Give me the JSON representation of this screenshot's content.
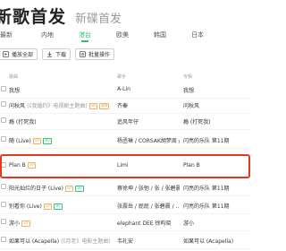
{
  "header": {
    "title": "新歌首发",
    "subtitle": "新碟首发"
  },
  "tabs": [
    {
      "label": "最新"
    },
    {
      "label": "内地"
    },
    {
      "label": "港台"
    },
    {
      "label": "欧美"
    },
    {
      "label": "韩国"
    },
    {
      "label": "日本"
    }
  ],
  "toolbar": {
    "play_all": "播放全部",
    "download": "下载",
    "batch": "批量操作"
  },
  "columns": {
    "title": "歌曲",
    "singer": "歌手",
    "album": "专辑"
  },
  "songs": [
    {
      "title": "我想",
      "alias": "",
      "tags": [],
      "singer": "A-Lin",
      "album": "我想"
    },
    {
      "title": "问秋风",
      "alias": "(《我婚约》电视剧主题曲)",
      "tags": [
        "VIP",
        "超清"
      ],
      "singer": "齐秦",
      "album": "问秋风"
    },
    {
      "title": "瘾 (打死我)",
      "alias": "",
      "tags": [],
      "singer": "追风年仔",
      "album": "瘾 (打死我)"
    },
    {
      "title": "随 (Live)",
      "alias": "",
      "tags": [
        "VIP",
        "MV"
      ],
      "singer": "杨丞琳 / CORSAK胡梦周 / ...",
      "album": "闪亮的乐队 第11期"
    },
    {
      "title": "Plan B",
      "alias": "",
      "tags": [
        "VIP"
      ],
      "singer": "Limi",
      "album": "Plan B"
    },
    {
      "title": "阳光灿烂的日子 (Live)",
      "alias": "",
      "tags": [
        "VIP",
        "MV"
      ],
      "singer": "蔡徐坤 / 张弛 / 张 / 张碧晨",
      "album": "闪亮的乐队 第11期"
    },
    {
      "title": "别看你 (Live)",
      "alias": "",
      "tags": [
        "VIP",
        "MV"
      ],
      "singer": "张震岳 / 屁屁 / 张碧晨 / ...",
      "album": "闪亮的乐队 第11期"
    },
    {
      "title": "游小",
      "alias": "",
      "tags": [
        "VIP"
      ],
      "singer": "elephant DEE 徐昀晓",
      "album": "游小"
    },
    {
      "title": "如果可以 (Acapella)",
      "alias": "(《月老》电影主题曲)",
      "tags": [],
      "singer": "韦礼安",
      "album": "如果可以 (Acapella)"
    }
  ]
}
